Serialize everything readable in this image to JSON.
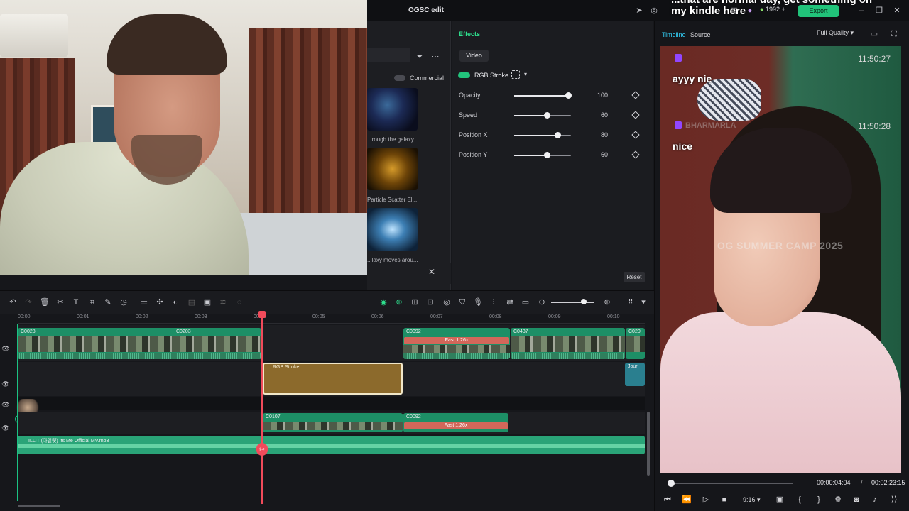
{
  "app": {
    "title": "OGSC edit",
    "credits": "1992",
    "export_label": "Export"
  },
  "overlay_caption": "...that are normal day, get something on my kindle here",
  "media_panel": {
    "commercial_label": "Commercial",
    "items": [
      {
        "caption": "...rough the galaxy..."
      },
      {
        "caption": "Particle Scatter El..."
      },
      {
        "caption": "...laxy moves arou..."
      }
    ]
  },
  "effects": {
    "title": "Effects",
    "tab_video": "Video",
    "effect_name": "RGB Stroke",
    "reset_label": "Reset",
    "params": [
      {
        "label": "Opacity",
        "value": "100",
        "fraction": 1.0
      },
      {
        "label": "Speed",
        "value": "60",
        "fraction": 0.6
      },
      {
        "label": "Position X",
        "value": "80",
        "fraction": 0.8
      },
      {
        "label": "Position Y",
        "value": "60",
        "fraction": 0.6
      }
    ]
  },
  "preview": {
    "tab_timeline": "Timeline",
    "tab_source": "Source",
    "quality": "Full Quality",
    "watermark": "OG SUMMER CAMP 2025",
    "chat": [
      {
        "user": "",
        "time": "11:50:27",
        "message": "ayyy nie"
      },
      {
        "user": "BHARMARLA",
        "time": "11:50:28",
        "message": "nice"
      }
    ],
    "time_current": "00:00:04:04",
    "time_separator": "/",
    "time_total": "00:02:23:15",
    "ratio": "9:16",
    "playback_fraction": 0.03
  },
  "timeline": {
    "ruler_labels": [
      "00:00",
      "00:01",
      "00:02",
      "00:03",
      "00:04",
      "00:05",
      "00:06",
      "00:07",
      "00:08",
      "00:09",
      "00:10"
    ],
    "video_clips_track1": [
      {
        "name": "C0028"
      },
      {
        "name": "C0203"
      },
      {
        "name": "C0092"
      },
      {
        "name": "C0437"
      },
      {
        "name": "C020"
      }
    ],
    "speed_label": "Fast 1.26x",
    "effect_clip_label": "RGB Stroke",
    "track1_extra": "Jour",
    "video_clips_track2": [
      {
        "name": "C0107"
      },
      {
        "name": "C0092"
      }
    ],
    "audio_label": "ILLIT (아일릿) Its Me Official MV.mp3"
  },
  "icons": {
    "undo": "undo-icon",
    "redo": "redo-icon",
    "delete": "trash-icon",
    "split": "scissors-icon",
    "text": "text-icon",
    "crop": "crop-icon",
    "keyframe": "pen-icon",
    "timer": "timer-icon"
  },
  "colors": {
    "accent": "#21c37a",
    "playhead": "#f14b5b",
    "effect_clip": "#8c6a2c",
    "twitch": "#9146ff"
  }
}
